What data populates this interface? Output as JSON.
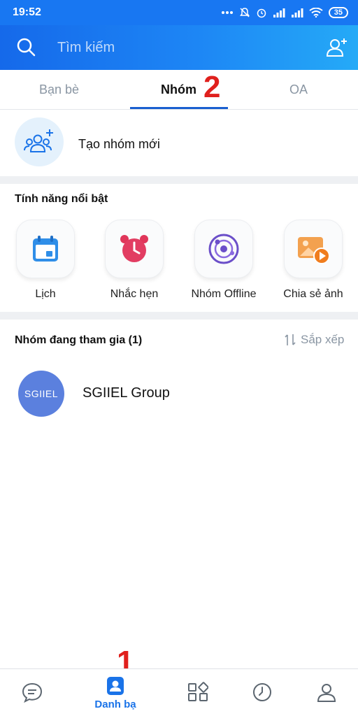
{
  "status_bar": {
    "time": "19:52",
    "battery": "35",
    "icons": [
      "more-dots-icon",
      "bell-off-icon",
      "alarm-icon",
      "signal-icon",
      "signal-icon",
      "wifi-icon",
      "battery-icon"
    ]
  },
  "search": {
    "placeholder": "Tìm kiếm",
    "icon": "search-icon",
    "add_friend_icon": "add-friend-icon"
  },
  "tabs": [
    {
      "label": "Bạn bè",
      "active": false
    },
    {
      "label": "Nhóm",
      "active": true
    },
    {
      "label": "OA",
      "active": false
    }
  ],
  "annotations": {
    "tab_marker": "2",
    "nav_marker": "1"
  },
  "create_group": {
    "label": "Tạo nhóm mới",
    "icon": "add-group-icon"
  },
  "features": {
    "title": "Tính năng nổi bật",
    "items": [
      {
        "label": "Lịch",
        "icon": "calendar-icon"
      },
      {
        "label": "Nhắc hẹn",
        "icon": "alarm-clock-icon"
      },
      {
        "label": "Nhóm Offline",
        "icon": "orbit-icon"
      },
      {
        "label": "Chia sẻ ảnh",
        "icon": "photo-share-icon"
      }
    ]
  },
  "joined_groups": {
    "title": "Nhóm đang tham gia (1)",
    "sort_label": "Sắp xếp",
    "items": [
      {
        "avatar_text": "SGIIEL",
        "name": "SGIIEL Group",
        "avatar_color": "#5b80de"
      }
    ]
  },
  "bottom_nav": {
    "active_label": "Danh bạ",
    "items": [
      "messages-icon",
      "contacts-icon",
      "discover-icon",
      "timeline-icon",
      "profile-icon"
    ]
  },
  "colors": {
    "primary": "#1877f2",
    "annotation_red": "#e0201d",
    "tab_indicator": "#1a5fd0"
  }
}
